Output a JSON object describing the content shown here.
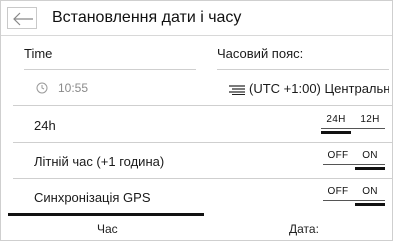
{
  "header": {
    "title": "Встановлення дати і часу"
  },
  "time_section": {
    "label": "Time",
    "value": "10:55"
  },
  "timezone_section": {
    "label": "Часовий пояс:",
    "value": "(UTC +1:00) Центральна ..."
  },
  "settings": [
    {
      "label": "24h",
      "toggle": {
        "left": "24H",
        "right": "12H",
        "selected": "24H"
      }
    },
    {
      "label": "Літній час (+1 година)",
      "toggle": {
        "left": "OFF",
        "right": "ON",
        "selected": "ON"
      }
    },
    {
      "label": "Синхронізація GPS",
      "toggle": {
        "left": "OFF",
        "right": "ON",
        "selected": "ON"
      }
    }
  ],
  "tabs": [
    {
      "label": "Час",
      "active": true
    },
    {
      "label": "Дата:",
      "active": false
    }
  ],
  "icons": {
    "back": "back-arrow-icon",
    "clock": "clock-icon",
    "timezone": "list-icon"
  }
}
